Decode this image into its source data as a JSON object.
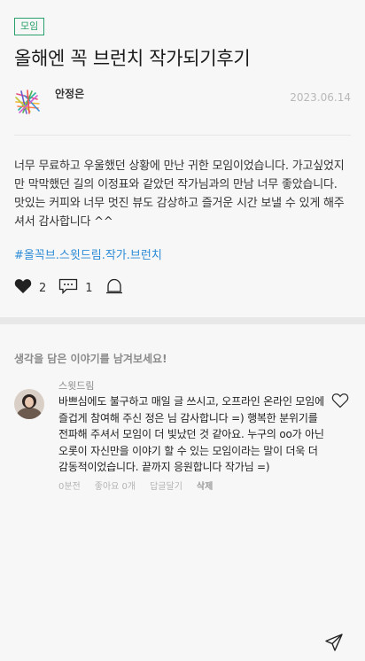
{
  "post": {
    "badge": "모임",
    "title": "올해엔 꼭 브런치 작가되기후기",
    "author": "안정은",
    "date": "2023.06.14",
    "body": "너무 무료하고 우울했던 상황에 만난 귀한 모임이었습니다. 가고싶었지만 막막했던 길의 이정표와 같았던 작가님과의 만남 너무 좋았습니다. 맛있는 커피와 너무 멋진 뷰도 감상하고 즐거운 시간 보낼 수 있게 해주셔서 감사합니다 ^^",
    "hashtags": "#올꼭브.스윗드림.작가.브런치",
    "like_count": "2",
    "comment_count": "1"
  },
  "comments_section": {
    "prompt": "생각을 담은 이야기를 남겨보세요!",
    "items": [
      {
        "name": "스윗드림",
        "text": "바쁘심에도 불구하고 매일 글 쓰시고, 오프라인 온라인 모임에 즐겁게 참여해 주신 정은 님 감사합니다 =) 행복한 분위기를 전파해 주셔서 모임이 더 빛났던 것 같아요. 누구의 oo가 아닌 오롯이 자신만을 이야기 할 수 있는 모임이라는 말이 더욱 더 감동적이었습니다. 끝까지 응원합니다 작가님 =)",
        "time": "0분전",
        "likes": "좋아요 0개",
        "reply": "답글달기",
        "delete": "삭제"
      }
    ]
  },
  "icons": {
    "like": "heart-icon",
    "comment": "speech-bubble-icon",
    "bell": "bell-icon",
    "comment_like": "heart-outline-icon",
    "send": "send-icon"
  }
}
